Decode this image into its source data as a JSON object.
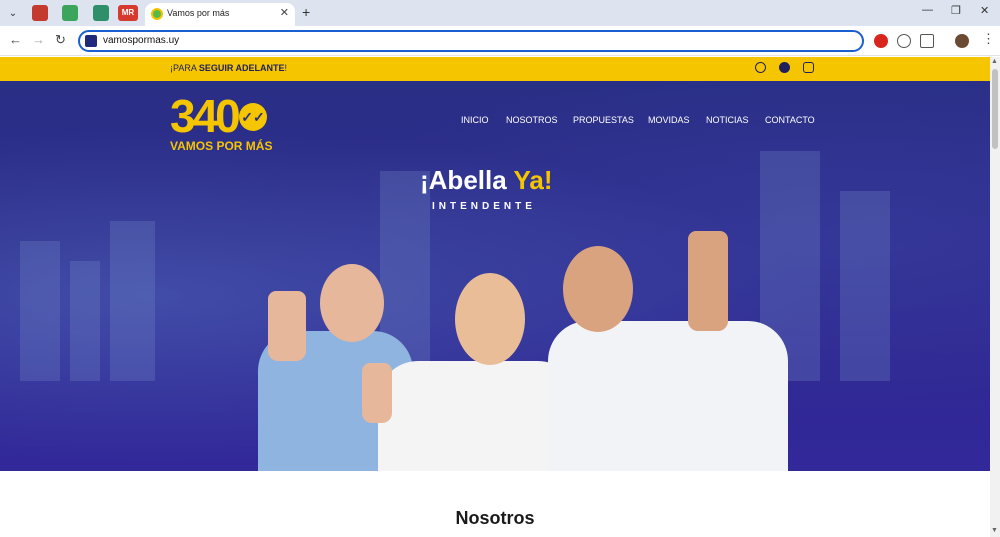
{
  "browser": {
    "tab_title": "Vamos por más",
    "pinned_tab_4": "MR",
    "url": "vamospormas.uy"
  },
  "page": {
    "top_strip": {
      "prefix": "¡PARA ",
      "bold": "SEGUIR ADELANTE",
      "suffix": "!"
    },
    "social_icons": [
      "whatsapp-icon",
      "facebook-icon",
      "instagram-icon"
    ],
    "logo": {
      "number": "340",
      "tagline": "VAMOS POR MÁS"
    },
    "nav": [
      "INICIO",
      "NOSOTROS",
      "PROPUESTAS",
      "MOVIDAS",
      "NOTICIAS",
      "CONTACTO"
    ],
    "hero": {
      "headline_main": "¡Abella",
      "headline_accent": "Ya!",
      "subline": "INTENDENTE"
    },
    "section_title": "Nosotros"
  },
  "colors": {
    "brand_yellow": "#f5c500",
    "brand_blue": "#2a2f86",
    "accent_focus": "#1a5fd1"
  }
}
